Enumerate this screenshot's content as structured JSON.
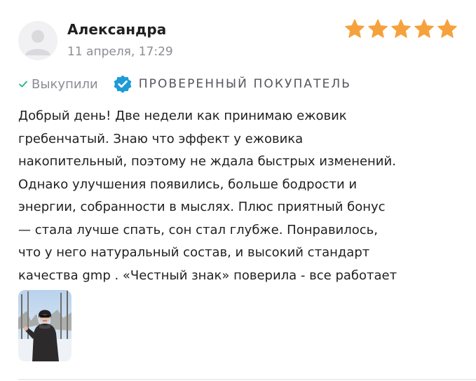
{
  "review": {
    "author_name": "Александра",
    "date": "11 апреля, 17:29",
    "rating": 5,
    "rating_max": 5,
    "star_color": "#f5a23c",
    "bought_label": "Выкупили",
    "verified_label": "ПРОВЕРЕННЫЙ ПОКУПАТЕЛЬ",
    "verified_color": "#1e9bd7",
    "check_color": "#25b37a",
    "text_lines": [
      "Добрый день! Две недели как принимаю ежовик",
      "гребенчатый. Знаю что эффект у ежовика",
      "накопительный, поэтому не ждала быстрых изменений.",
      "Однако улучшения появились, больше бодрости и",
      "энергии, собранности в мыслях. Плюс приятный бонус",
      "— стала лучше спать, сон стал глубже. Понравилось,",
      "что у него натуральный состав, и высокий стандарт",
      "качества gmp . «Честный знак» поверила - все работает"
    ],
    "photo_count": 1
  }
}
